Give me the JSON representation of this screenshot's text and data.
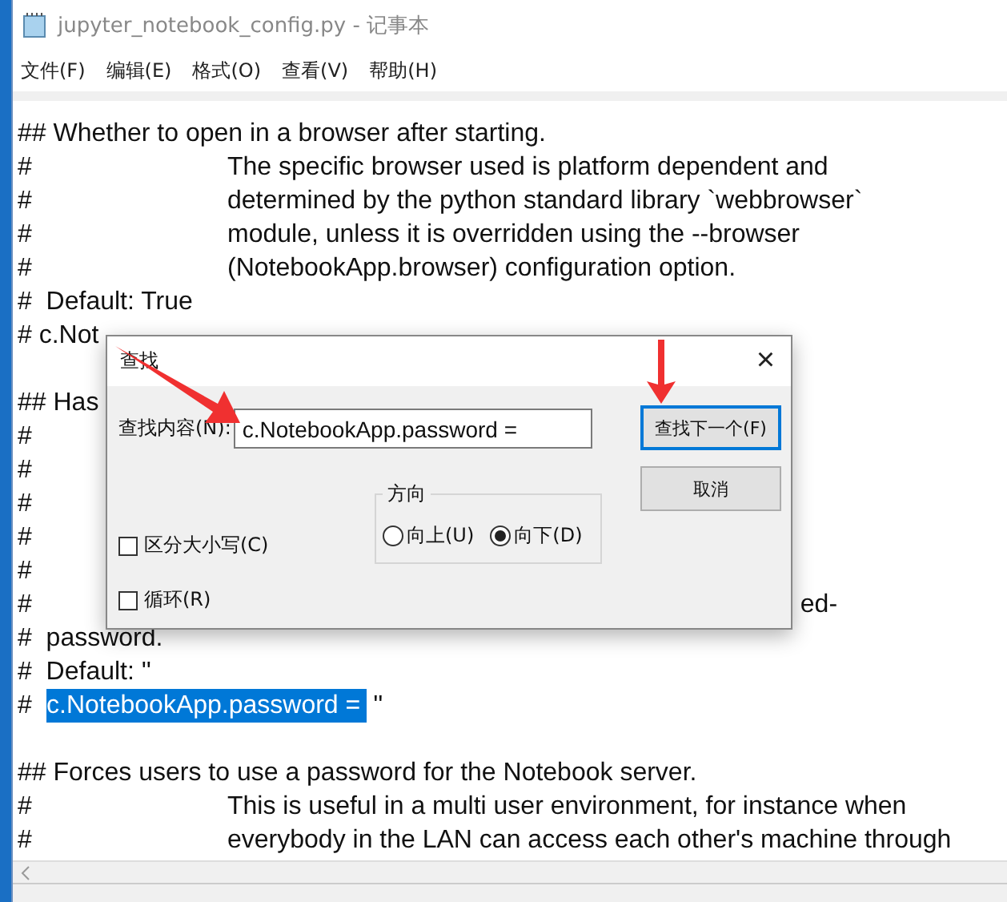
{
  "window": {
    "title": "jupyter_notebook_config.py - 记事本"
  },
  "menu": [
    "文件(F)",
    "编辑(E)",
    "格式(O)",
    "查看(V)",
    "帮助(H)"
  ],
  "lines": [
    {
      "kind": "plain",
      "text": "## Whether to open in a browser after starting."
    },
    {
      "kind": "indent",
      "marker": "#",
      "text": "The specific browser used is platform dependent and"
    },
    {
      "kind": "indent",
      "marker": "#",
      "text": "determined by the python standard library `webbrowser`"
    },
    {
      "kind": "indent",
      "marker": "#",
      "text": "module, unless it is overridden using the --browser"
    },
    {
      "kind": "indent",
      "marker": "#",
      "text": "(NotebookApp.browser) configuration option."
    },
    {
      "kind": "plain",
      "text": "#  Default: True"
    },
    {
      "kind": "plain",
      "text": "# c.Not"
    },
    {
      "kind": "blank"
    },
    {
      "kind": "plain",
      "text": "## Has"
    },
    {
      "kind": "plain",
      "text": "#"
    },
    {
      "kind": "plain",
      "text": "#"
    },
    {
      "kind": "plain",
      "text": "#"
    },
    {
      "kind": "plain",
      "text": "#"
    },
    {
      "kind": "plain",
      "text": "#"
    },
    {
      "kind": "plain",
      "text": "#",
      "tail": "ed-"
    },
    {
      "kind": "plain",
      "text": "#  password."
    },
    {
      "kind": "plain",
      "text": "#  Default: ''"
    },
    {
      "kind": "match",
      "marker": "#",
      "match": "c.NotebookApp.password =",
      "text": "''"
    },
    {
      "kind": "blank"
    },
    {
      "kind": "plain",
      "text": "## Forces users to use a password for the Notebook server."
    },
    {
      "kind": "indent",
      "marker": "#",
      "text": "This is useful in a multi user environment, for instance when"
    },
    {
      "kind": "indent",
      "marker": "#",
      "text": "everybody in the LAN can access each other's machine through"
    }
  ],
  "dialog": {
    "title": "查找",
    "close": "×",
    "find_label": "查找内容(N):",
    "find_value": "c.NotebookApp.password =",
    "buttons": [
      {
        "label": "查找下一个(F)",
        "focused": true
      },
      {
        "label": "取消",
        "focused": false
      }
    ],
    "direction": {
      "label": "方向",
      "options": [
        {
          "label": "向上(U)",
          "selected": false
        },
        {
          "label": "向下(D)",
          "selected": true
        }
      ]
    },
    "checkboxes": [
      {
        "label": "区分大小写(C)",
        "checked": false
      },
      {
        "label": "循环(R)",
        "checked": false
      }
    ]
  }
}
